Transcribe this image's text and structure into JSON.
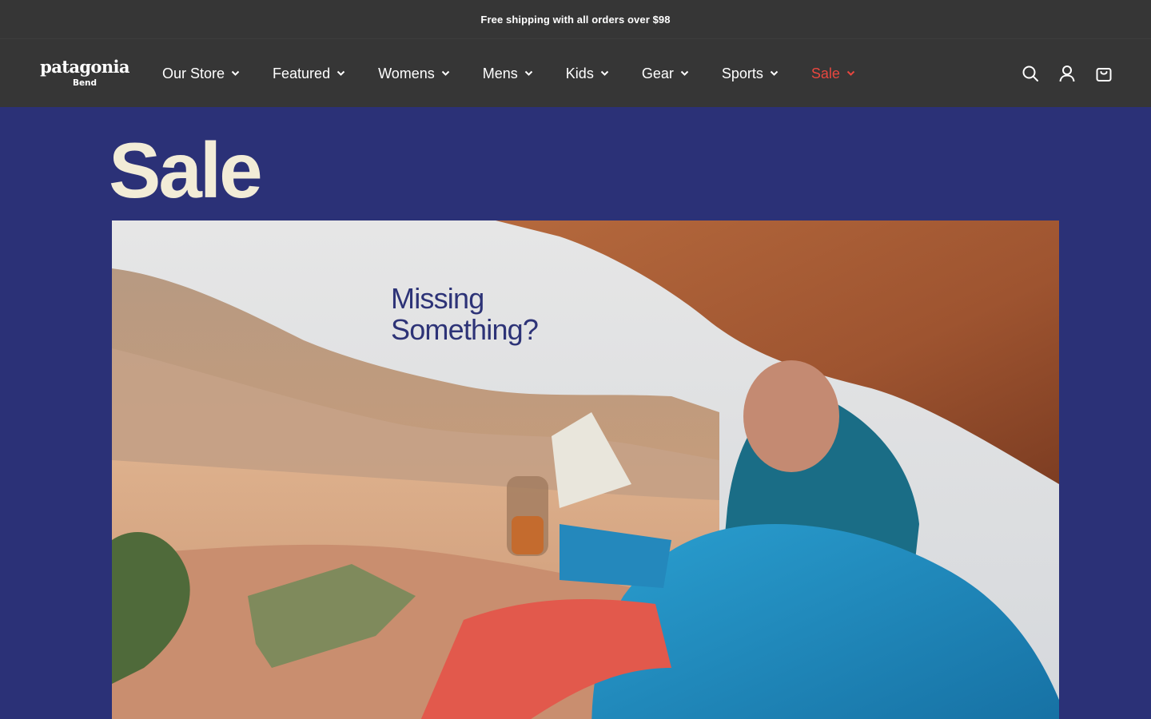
{
  "announcement": {
    "text": "Free shipping with all orders over $98"
  },
  "brand": {
    "name": "patagonia",
    "location": "Bend"
  },
  "nav": {
    "items": [
      {
        "label": "Our Store"
      },
      {
        "label": "Featured"
      },
      {
        "label": "Womens"
      },
      {
        "label": "Mens"
      },
      {
        "label": "Kids"
      },
      {
        "label": "Gear"
      },
      {
        "label": "Sports"
      },
      {
        "label": "Sale"
      }
    ]
  },
  "header_icons": [
    "search-icon",
    "account-icon",
    "cart-icon"
  ],
  "page": {
    "title": "Sale"
  },
  "hero": {
    "line1": "Missing",
    "line2": "Something?"
  },
  "colors": {
    "announcement_bg": "#363636",
    "header_bg": "#363636",
    "page_bg": "#2b3177",
    "sale_accent": "#e8473f",
    "title_color": "#f2ecd7",
    "hero_text": "#2d3377"
  }
}
